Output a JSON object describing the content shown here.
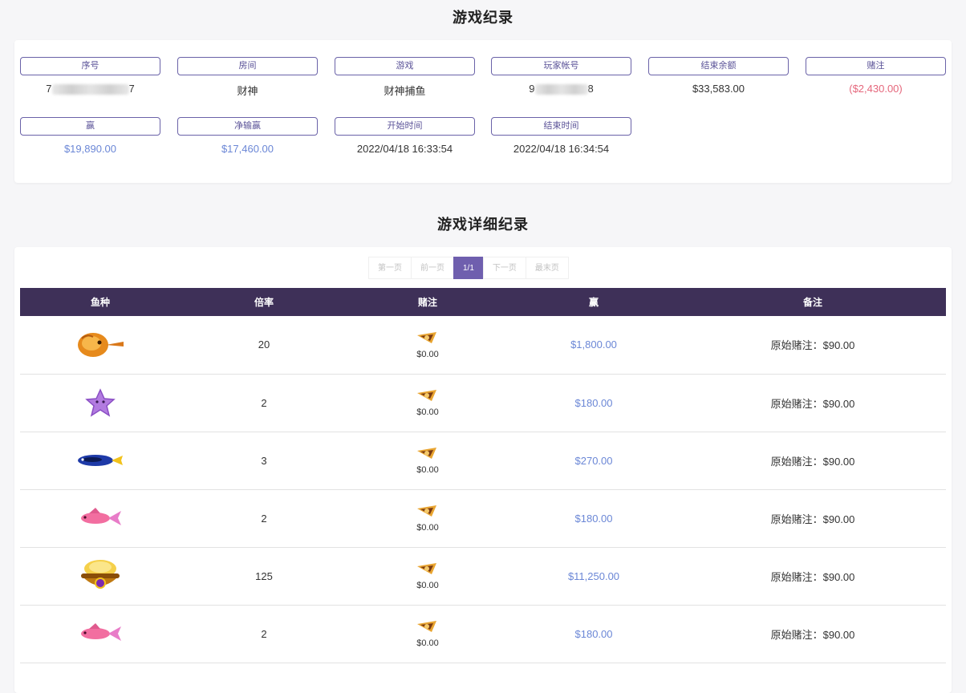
{
  "title": "游戏纪录",
  "summary": {
    "fields": [
      {
        "label": "序号",
        "value_prefix": "7",
        "value_suffix": "7",
        "masked": true
      },
      {
        "label": "房间",
        "value": "财神"
      },
      {
        "label": "游戏",
        "value": "财神捕鱼"
      },
      {
        "label": "玩家帐号",
        "value_prefix": "9",
        "value_suffix": "8",
        "masked": true
      },
      {
        "label": "结束余额",
        "value": "$33,583.00"
      },
      {
        "label": "赌注",
        "value": "($2,430.00)",
        "color": "#e5677c"
      },
      {
        "label": "赢",
        "value": "$19,890.00",
        "color": "#6b87d6"
      },
      {
        "label": "净输赢",
        "value": "$17,460.00",
        "color": "#6b87d6"
      },
      {
        "label": "开始时间",
        "value": "2022/04/18 16:33:54"
      },
      {
        "label": "结束时间",
        "value": "2022/04/18 16:34:54"
      }
    ]
  },
  "detail_title": "游戏详细纪录",
  "pager": {
    "first": "第一页",
    "prev": "前一页",
    "current": "1/1",
    "next": "下一页",
    "last": "最末页"
  },
  "table": {
    "headers": [
      "鱼种",
      "倍率",
      "赌注",
      "赢",
      "备注"
    ],
    "rows": [
      {
        "fish": "orange-lanternfish-icon",
        "rate": "20",
        "bet": "$0.00",
        "win": "$1,800.00",
        "note": "原始赌注：$90.00"
      },
      {
        "fish": "purple-starfish-icon",
        "rate": "2",
        "bet": "$0.00",
        "win": "$180.00",
        "note": "原始赌注：$90.00"
      },
      {
        "fish": "blue-tang-fish-icon",
        "rate": "3",
        "bet": "$0.00",
        "win": "$270.00",
        "note": "原始赌注：$90.00"
      },
      {
        "fish": "pink-fish-icon",
        "rate": "2",
        "bet": "$0.00",
        "win": "$180.00",
        "note": "原始赌注：$90.00"
      },
      {
        "fish": "treasure-bowl-icon",
        "rate": "125",
        "bet": "$0.00",
        "win": "$11,250.00",
        "note": "原始赌注：$90.00"
      },
      {
        "fish": "pink-fish-icon",
        "rate": "2",
        "bet": "$0.00",
        "win": "$180.00",
        "note": "原始赌注：$90.00"
      }
    ]
  },
  "colors": {
    "accent": "#6f5fae",
    "table_header": "#3e3058",
    "win_blue": "#6b87d6",
    "loss_red": "#e5677c"
  }
}
